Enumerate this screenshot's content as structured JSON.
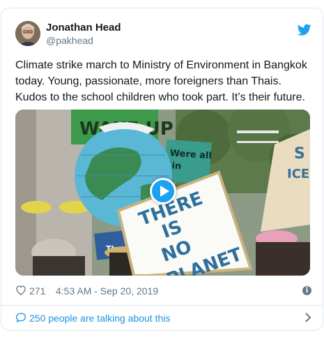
{
  "tweet": {
    "display_name": "Jonathan Head",
    "handle": "@pakhead",
    "text": "Climate strike march to Ministry of Environment in Bangkok today. Young, passionate, more foreigners than Thais. Kudos to the school children who took part. It’s their future.",
    "likes": "271",
    "timestamp": "4:53 AM - Sep 20, 2019",
    "talking": "250 people are talking about this",
    "media": {
      "type": "video",
      "signs": {
        "main": [
          "THERE",
          "IS",
          "NO",
          "PLANET"
        ],
        "back": [
          "Were all",
          "in"
        ],
        "right": [
          "S",
          "ICE"
        ],
        "top": "WAKE UP",
        "small": "The"
      }
    }
  },
  "colors": {
    "accent": "#1da1f2",
    "link": "#1b95e0",
    "muted": "#657786",
    "border": "#e1e8ed"
  },
  "icons": [
    "twitter-bird-icon",
    "heart-icon",
    "info-icon",
    "speech-bubble-icon",
    "chevron-right-icon",
    "play-icon"
  ]
}
